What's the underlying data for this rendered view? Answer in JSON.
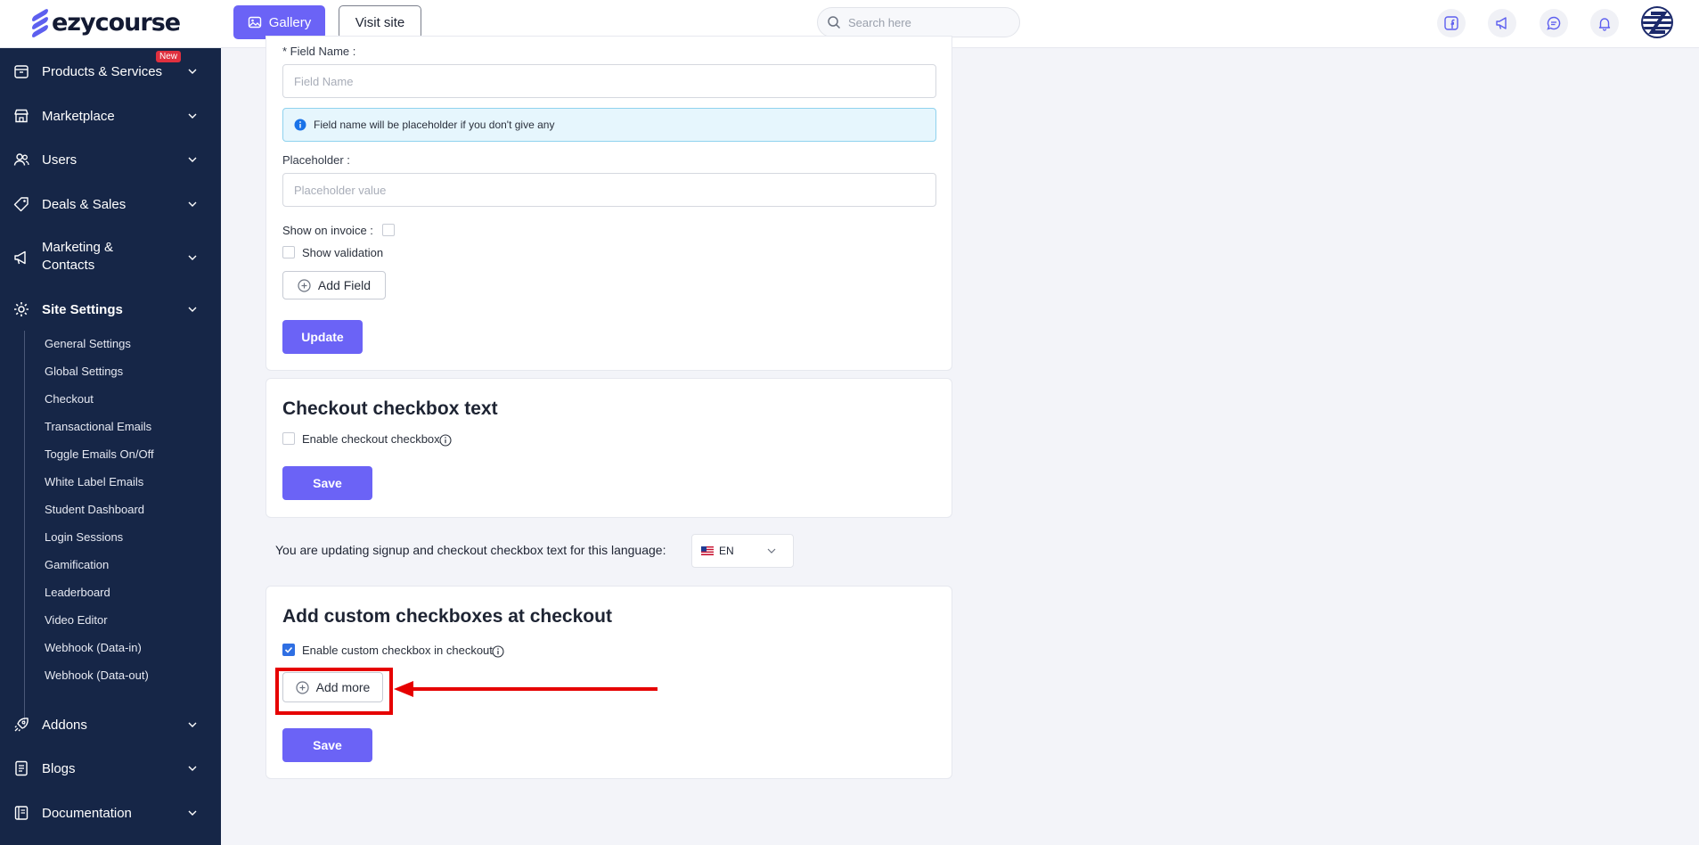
{
  "header": {
    "logo_text": "ezycourse",
    "gallery_label": "Gallery",
    "visit_site_label": "Visit site",
    "search_placeholder": "Search here"
  },
  "sidebar": {
    "items": [
      {
        "label": "Products & Services",
        "icon": "box-icon"
      },
      {
        "label": "Marketplace",
        "icon": "store-icon"
      },
      {
        "label": "Users",
        "icon": "users-icon"
      },
      {
        "label": "Deals & Sales",
        "icon": "tag-icon"
      },
      {
        "label": "Marketing & Contacts",
        "icon": "megaphone-icon",
        "badge": "New"
      },
      {
        "label": "Site Settings",
        "icon": "gear-icon",
        "active": true
      },
      {
        "label": "Addons",
        "icon": "rocket-icon"
      },
      {
        "label": "Blogs",
        "icon": "document-icon"
      },
      {
        "label": "Documentation",
        "icon": "book-icon"
      }
    ],
    "marketing_line1": "Marketing &",
    "marketing_line2": "Contacts",
    "sub_items": [
      "General Settings",
      "Global Settings",
      "Checkout",
      "Transactional Emails",
      "Toggle Emails On/Off",
      "White Label Emails",
      "Student Dashboard",
      "Login Sessions",
      "Gamification",
      "Leaderboard",
      "Video Editor",
      "Webhook (Data-in)",
      "Webhook (Data-out)"
    ]
  },
  "field_card": {
    "field_name_label": "* Field Name :",
    "field_name_placeholder": "Field Name",
    "info_text": "Field name will be placeholder if you don't give any",
    "placeholder_label": "Placeholder :",
    "placeholder_placeholder": "Placeholder value",
    "show_on_invoice_label": "Show on invoice :",
    "show_validation_label": "Show validation",
    "add_field_label": "Add Field",
    "update_label": "Update"
  },
  "checkout_checkbox_card": {
    "title": "Checkout checkbox text",
    "enable_label": "Enable checkout checkbox",
    "save_label": "Save"
  },
  "language": {
    "text": "You are updating signup and checkout checkbox text for this language:",
    "selected": "EN"
  },
  "custom_checkbox_card": {
    "title": "Add custom checkboxes at checkout",
    "enable_label": "Enable custom checkbox in checkout",
    "enable_checked": true,
    "add_more_label": "Add more",
    "save_label": "Save"
  },
  "colors": {
    "primary": "#6b63f6",
    "sidebar_bg": "#162647",
    "highlight": "#e60000"
  }
}
